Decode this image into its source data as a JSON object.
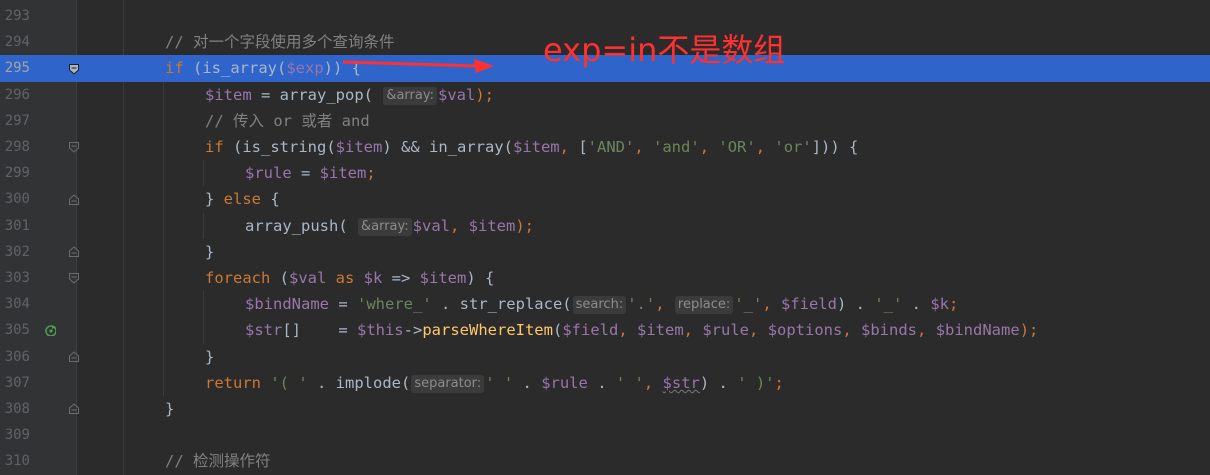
{
  "lines": [
    {
      "num": "293",
      "indent": 0,
      "tokens": []
    },
    {
      "num": "294",
      "indent": 4,
      "tokens": [
        {
          "t": "// 对一个字段使用多个查询条件",
          "c": "cm"
        }
      ]
    },
    {
      "num": "295",
      "indent": 4,
      "current": true,
      "tokens": [
        {
          "t": "if",
          "c": "kw"
        },
        {
          "t": " (is_array(",
          "c": "pl"
        },
        {
          "t": "$exp",
          "c": "var"
        },
        {
          "t": ")) {",
          "c": "pl"
        }
      ]
    },
    {
      "num": "296",
      "indent": 8,
      "tokens": [
        {
          "t": "$item",
          "c": "var"
        },
        {
          "t": " = array_pop( ",
          "c": "pl"
        },
        {
          "hint": "&array:"
        },
        {
          "t": "$val",
          "c": "var"
        },
        {
          "t": ");",
          "c": "kw"
        }
      ]
    },
    {
      "num": "297",
      "indent": 8,
      "tokens": [
        {
          "t": "// 传入 or 或者 and",
          "c": "cm"
        }
      ]
    },
    {
      "num": "298",
      "indent": 8,
      "tokens": [
        {
          "t": "if",
          "c": "kw"
        },
        {
          "t": " (is_string(",
          "c": "pl"
        },
        {
          "t": "$item",
          "c": "var"
        },
        {
          "t": ") && in_array(",
          "c": "pl"
        },
        {
          "t": "$item",
          "c": "var"
        },
        {
          "t": ", ",
          "c": "kw"
        },
        {
          "t": "[",
          "c": "pl"
        },
        {
          "t": "'AND'",
          "c": "str"
        },
        {
          "t": ", ",
          "c": "kw"
        },
        {
          "t": "'and'",
          "c": "str"
        },
        {
          "t": ", ",
          "c": "kw"
        },
        {
          "t": "'OR'",
          "c": "str"
        },
        {
          "t": ", ",
          "c": "kw"
        },
        {
          "t": "'or'",
          "c": "str"
        },
        {
          "t": "])) {",
          "c": "pl"
        }
      ]
    },
    {
      "num": "299",
      "indent": 12,
      "tokens": [
        {
          "t": "$rule",
          "c": "var"
        },
        {
          "t": " = ",
          "c": "pl"
        },
        {
          "t": "$item",
          "c": "var"
        },
        {
          "t": ";",
          "c": "kw"
        }
      ]
    },
    {
      "num": "300",
      "indent": 8,
      "tokens": [
        {
          "t": "} ",
          "c": "pl"
        },
        {
          "t": "else",
          "c": "kw"
        },
        {
          "t": " {",
          "c": "pl"
        }
      ]
    },
    {
      "num": "301",
      "indent": 12,
      "tokens": [
        {
          "t": "array_push( ",
          "c": "pl"
        },
        {
          "hint": "&array:"
        },
        {
          "t": "$val",
          "c": "var"
        },
        {
          "t": ", ",
          "c": "kw"
        },
        {
          "t": "$item",
          "c": "var"
        },
        {
          "t": ");",
          "c": "kw"
        }
      ]
    },
    {
      "num": "302",
      "indent": 8,
      "tokens": [
        {
          "t": "}",
          "c": "pl"
        }
      ]
    },
    {
      "num": "303",
      "indent": 8,
      "tokens": [
        {
          "t": "foreach",
          "c": "kw"
        },
        {
          "t": " (",
          "c": "pl"
        },
        {
          "t": "$val",
          "c": "var"
        },
        {
          "t": " as ",
          "c": "kw"
        },
        {
          "t": "$k",
          "c": "var"
        },
        {
          "t": " => ",
          "c": "pl"
        },
        {
          "t": "$item",
          "c": "var"
        },
        {
          "t": ") {",
          "c": "pl"
        }
      ]
    },
    {
      "num": "304",
      "indent": 12,
      "tokens": [
        {
          "t": "$bindName",
          "c": "var"
        },
        {
          "t": " = ",
          "c": "pl"
        },
        {
          "t": "'where_'",
          "c": "str"
        },
        {
          "t": " . str_replace(",
          "c": "pl"
        },
        {
          "hint": "search:"
        },
        {
          "t": "'.'",
          "c": "str"
        },
        {
          "t": ", ",
          "c": "kw"
        },
        {
          "hint": "replace:"
        },
        {
          "t": "'_'",
          "c": "str"
        },
        {
          "t": ", ",
          "c": "kw"
        },
        {
          "t": "$field",
          "c": "var"
        },
        {
          "t": ") . ",
          "c": "pl"
        },
        {
          "t": "'_'",
          "c": "str"
        },
        {
          "t": " . ",
          "c": "pl"
        },
        {
          "t": "$k",
          "c": "var"
        },
        {
          "t": ";",
          "c": "kw"
        }
      ]
    },
    {
      "num": "305",
      "indent": 12,
      "tokens": [
        {
          "t": "$str",
          "c": "var"
        },
        {
          "t": "[]    = ",
          "c": "pl"
        },
        {
          "t": "$this",
          "c": "var"
        },
        {
          "t": "->",
          "c": "pl"
        },
        {
          "t": "parseWhereItem",
          "c": "fn"
        },
        {
          "t": "(",
          "c": "pl"
        },
        {
          "t": "$field",
          "c": "var"
        },
        {
          "t": ", ",
          "c": "kw"
        },
        {
          "t": "$item",
          "c": "var"
        },
        {
          "t": ", ",
          "c": "kw"
        },
        {
          "t": "$rule",
          "c": "var"
        },
        {
          "t": ", ",
          "c": "kw"
        },
        {
          "t": "$options",
          "c": "var"
        },
        {
          "t": ", ",
          "c": "kw"
        },
        {
          "t": "$binds",
          "c": "var"
        },
        {
          "t": ", ",
          "c": "kw"
        },
        {
          "t": "$bindName",
          "c": "var"
        },
        {
          "t": ");",
          "c": "kw"
        }
      ]
    },
    {
      "num": "306",
      "indent": 8,
      "tokens": [
        {
          "t": "}",
          "c": "pl"
        }
      ]
    },
    {
      "num": "307",
      "indent": 8,
      "tokens": [
        {
          "t": "return",
          "c": "kw"
        },
        {
          "t": " ",
          "c": "pl"
        },
        {
          "t": "'( '",
          "c": "str"
        },
        {
          "t": " . implode(",
          "c": "pl"
        },
        {
          "hint": "separator:"
        },
        {
          "t": "' '",
          "c": "str"
        },
        {
          "t": " . ",
          "c": "pl"
        },
        {
          "t": "$rule",
          "c": "var"
        },
        {
          "t": " . ",
          "c": "pl"
        },
        {
          "t": "' '",
          "c": "str"
        },
        {
          "t": ", ",
          "c": "kw"
        },
        {
          "t": "$str",
          "c": "var",
          "u": true
        },
        {
          "t": ") . ",
          "c": "pl"
        },
        {
          "t": "' )'",
          "c": "str"
        },
        {
          "t": ";",
          "c": "kw"
        }
      ]
    },
    {
      "num": "308",
      "indent": 4,
      "tokens": [
        {
          "t": "}",
          "c": "pl"
        }
      ]
    },
    {
      "num": "309",
      "indent": 0,
      "tokens": []
    },
    {
      "num": "310",
      "indent": 4,
      "tokens": [
        {
          "t": "// 检测操作符",
          "c": "cm"
        }
      ]
    }
  ],
  "gutter_icons": [
    {
      "line": "295",
      "name": "fold-open-icon"
    },
    {
      "line": "298",
      "name": "fold-open-icon"
    },
    {
      "line": "300",
      "name": "fold-close-icon"
    },
    {
      "line": "302",
      "name": "fold-close-icon"
    },
    {
      "line": "303",
      "name": "fold-open-icon"
    },
    {
      "line": "305",
      "name": "recursive-call-icon"
    },
    {
      "line": "306",
      "name": "fold-close-icon"
    },
    {
      "line": "308",
      "name": "fold-close-icon"
    }
  ],
  "annotation": {
    "text": "exp=in不是数组",
    "color": "#ff3030"
  },
  "colors": {
    "background": "#2b2b2b",
    "gutter": "#313335",
    "current_line": "#2f65ca",
    "keyword": "#cc7832",
    "variable": "#9876aa",
    "string": "#6a8759",
    "comment": "#808080",
    "function": "#ffc66d",
    "plain": "#a9b7c6"
  }
}
